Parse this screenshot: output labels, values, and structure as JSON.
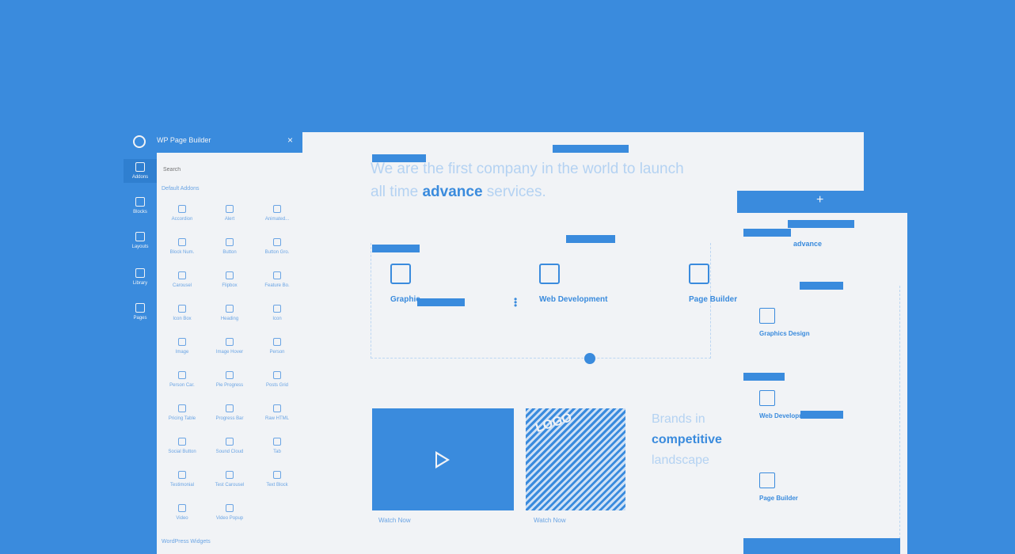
{
  "panel": {
    "title": "WP Page Builder",
    "close": "×",
    "search_placeholder": "Search",
    "default_addons_label": "Default Addons",
    "wordpress_widgets_label": "WordPress Widgets"
  },
  "rail": [
    {
      "label": "Addons",
      "icon": "addons-icon"
    },
    {
      "label": "Blocks",
      "icon": "blocks-icon"
    },
    {
      "label": "Layouts",
      "icon": "layouts-icon"
    },
    {
      "label": "Library",
      "icon": "library-icon"
    },
    {
      "label": "Pages",
      "icon": "pages-icon"
    }
  ],
  "addons": [
    "Accordion",
    "Alert",
    "Animated...",
    "Block Num.",
    "Button",
    "Button Gro.",
    "Carousel",
    "Flipbox",
    "Feature Bo.",
    "Icon Box",
    "Heading",
    "Icon",
    "Image",
    "Image Hover",
    "Person",
    "Person Car.",
    "Pie Progress",
    "Posts Grid",
    "Pricing Table",
    "Progress Bar",
    "Raw HTML",
    "Social Button",
    "Sound Cloud",
    "Tab",
    "Testimonial",
    "Test Carousel",
    "Text Block",
    "Video",
    "Video Popup"
  ],
  "hero": {
    "prefix": "We are the first company in the world to launch all time ",
    "highlight": "advance",
    "suffix": " services."
  },
  "services": [
    {
      "label": "Graphic",
      "icon": "graphics-design-icon"
    },
    {
      "label": "Web Development",
      "icon": "web-development-icon"
    },
    {
      "label": "Page Builder",
      "icon": "page-builder-icon"
    }
  ],
  "watch_labels": [
    "Watch Now",
    "Watch Now"
  ],
  "logo_text": "LOGO",
  "brands": {
    "line1": "Brands in",
    "highlight": "competitive",
    "line3": "landscape"
  },
  "mobile": {
    "plus": "+",
    "advance": "advance",
    "services": [
      "Graphics Design",
      "Web Development",
      "Page Builder"
    ]
  },
  "colors": {
    "background": "#3a8bdd",
    "surface": "#f1f3f6",
    "accent": "#3a8bdd"
  }
}
